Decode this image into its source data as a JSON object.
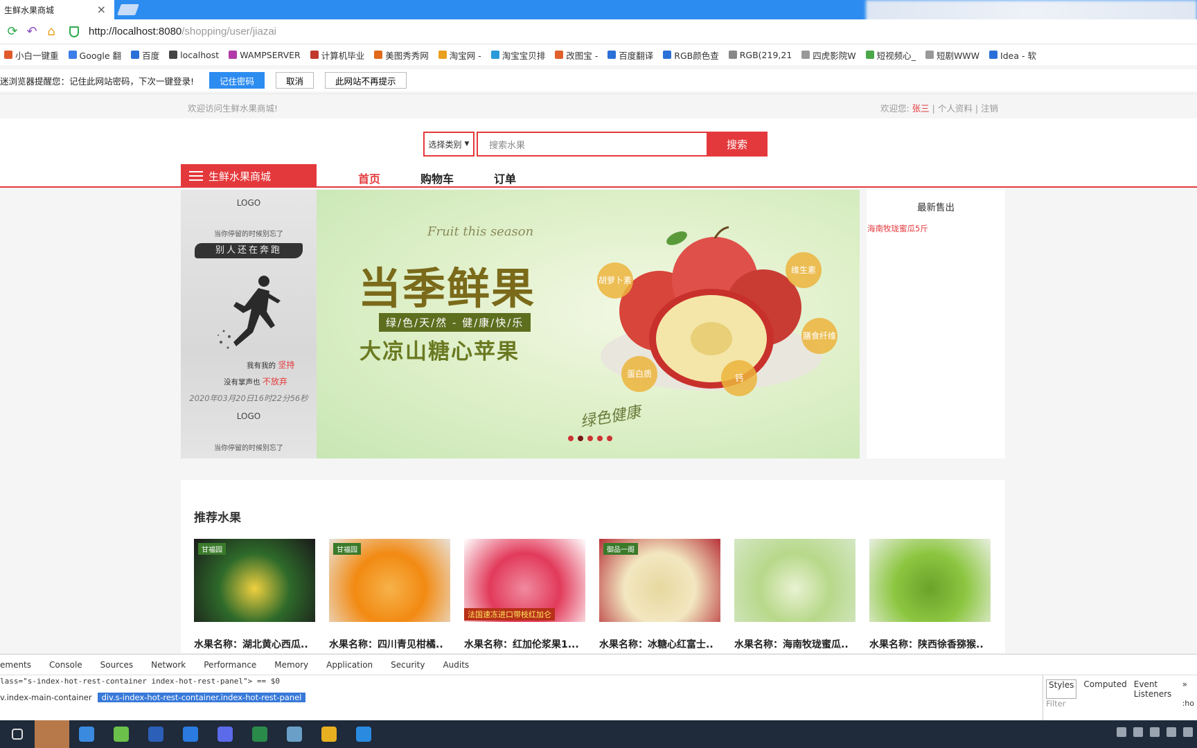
{
  "browser": {
    "tab_title": "生鲜水果商城",
    "tab_close": "×",
    "url_host": "http://localhost:8080",
    "url_path": "/shopping/user/jiazai",
    "bookmarks": [
      "小白一键重",
      "Google 翻",
      "百度",
      "localhost",
      "WAMPSERVER",
      "计算机毕业",
      "美图秀秀网",
      "淘宝网 -",
      "淘宝宝贝排",
      "改图宝 -",
      "百度翻译",
      "RGB颜色查",
      "RGB(219,21",
      "四虎影院W",
      "短视频心_",
      "短剧WWW",
      "Idea - 软"
    ],
    "bookmark_colors": [
      "#e05a2b",
      "#3b7de9",
      "#2b6fd8",
      "#444444",
      "#b03aa8",
      "#c0392b",
      "#e06a1a",
      "#e8a020",
      "#2a9ad8",
      "#e0602b",
      "#2b6fd8",
      "#2b6fd8",
      "#888888",
      "#999999",
      "#4aa84a",
      "#999999",
      "#2b6fd8"
    ],
    "password_prompt": {
      "message": "迷浏览器提醒您：记住此网站密码，下次一键登录!",
      "save_label": "记住密码",
      "cancel_label": "取消",
      "never_label": "此网站不再提示"
    }
  },
  "site": {
    "welcome": "欢迎访问生鲜水果商城!",
    "user_prefix": "欢迎您:",
    "user_name": "张三",
    "user_links": " | 个人资料 | 注销",
    "search": {
      "category": "选择类别",
      "category_arrow": "▼",
      "placeholder": "搜索水果",
      "button": "搜索"
    },
    "category_title": "生鲜水果商城",
    "nav": [
      "首页",
      "购物车",
      "订单"
    ],
    "left_ad": {
      "logo": "LOGO",
      "line1": "当你停留的时候别忘了",
      "brush": "别人还在奔跑",
      "slogan1_pre": "我有我的",
      "slogan1_em": "坚持",
      "slogan2_pre": "没有掌声也",
      "slogan2_em": "不放弃",
      "datetime": "2020年03月20日16时22分56秒",
      "logo2": "LOGO",
      "line2": "当你停留的时候别忘了"
    },
    "banner": {
      "english": "Fruit this season",
      "title": "当季鲜果",
      "tagline": "绿/色/天/然 - 健/康/快/乐",
      "subtitle": "大凉山糖心苹果",
      "footer": "绿色健康",
      "bubbles": [
        "胡萝卜素",
        "维生素",
        "膳食纤维",
        "蛋白质",
        "钙"
      ],
      "slide_count": 5,
      "active_slide": 2
    },
    "latest": {
      "title": "最新售出",
      "items": [
        "海南牧珑蜜瓜5斤"
      ]
    },
    "recommend": {
      "title": "推荐水果",
      "items": [
        {
          "name": "水果名称：湖北黄心西瓜..",
          "badge": "甘福园",
          "colors": [
            "#1a1a1a",
            "#2e6a2a",
            "#f0d040"
          ]
        },
        {
          "name": "水果名称：四川青见柑橘..",
          "badge": "甘福园",
          "colors": [
            "#e9e2d8",
            "#f28a12",
            "#f6b24a"
          ]
        },
        {
          "name": "水果名称：红加伦浆果1...",
          "badge": "法国速冻进口带枝红加仑",
          "colors": [
            "#ffffff",
            "#e23a5a",
            "#f08aa0"
          ]
        },
        {
          "name": "水果名称：冰糖心红富士..",
          "badge": "御品一阁",
          "colors": [
            "#b8323a",
            "#f2e7c0",
            "#e8d8a0"
          ]
        },
        {
          "name": "水果名称：海南牧珑蜜瓜..",
          "badge": "",
          "colors": [
            "#d4e7c4",
            "#b8d88a",
            "#e8f2d2"
          ]
        },
        {
          "name": "水果名称：陕西徐香猕猴..",
          "badge": "",
          "colors": [
            "#e8efe0",
            "#8cc640",
            "#6aa22a"
          ]
        }
      ]
    }
  },
  "devtools": {
    "tabs": [
      "ements",
      "Console",
      "Sources",
      "Network",
      "Performance",
      "Memory",
      "Application",
      "Security",
      "Audits"
    ],
    "code_line": "lass=\"s-index-hot-rest-container index-hot-rest-panel\"> == $0",
    "crumb_parent": "v.index-main-container",
    "crumb_selected": "div.s-index-hot-rest-container.index-hot-rest-panel",
    "right_tabs": [
      "Styles",
      "Computed",
      "Event Listeners"
    ],
    "filter_placeholder": "Filter",
    "more": "»",
    "hov": ":ho"
  },
  "taskbar": {
    "icon_colors": [
      "#dddddd",
      "#b8794a",
      "#3a8ae0",
      "#6ac04a",
      "#2b5fb8",
      "#2a7ae0",
      "#5a6ae8",
      "#2a8a4a",
      "#6aa0c8",
      "#e8b020",
      "#2a8ae0"
    ]
  }
}
